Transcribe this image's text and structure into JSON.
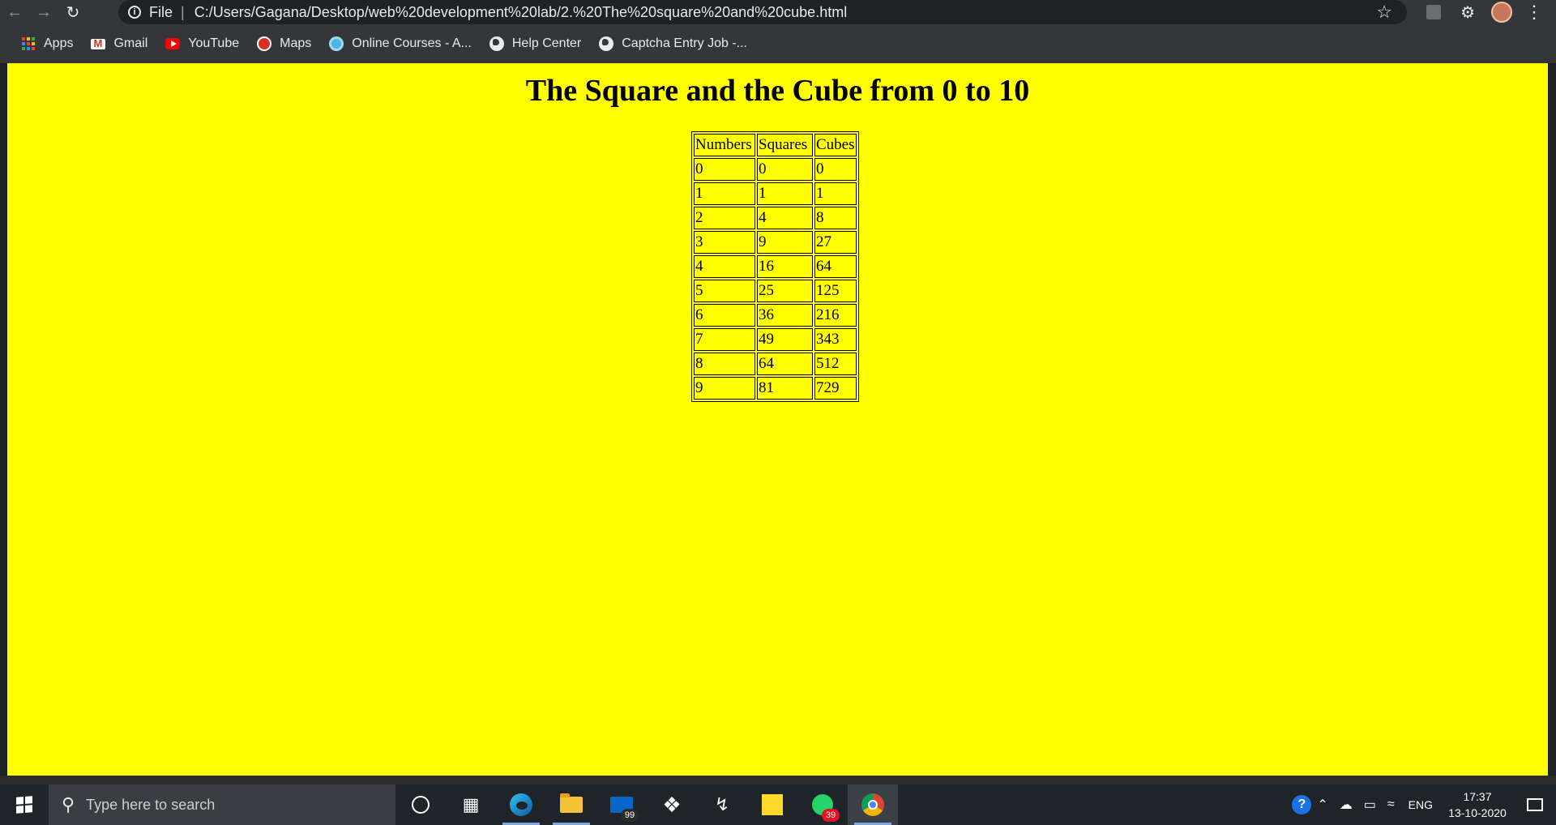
{
  "browser": {
    "url_scheme_label": "File",
    "url": "C:/Users/Gagana/Desktop/web%20development%20lab/2.%20The%20square%20and%20cube.html",
    "bookmarks": [
      {
        "label": "Apps",
        "icon": "apps-grid-icon"
      },
      {
        "label": "Gmail",
        "icon": "gmail-icon"
      },
      {
        "label": "YouTube",
        "icon": "youtube-icon"
      },
      {
        "label": "Maps",
        "icon": "maps-icon"
      },
      {
        "label": "Online Courses - A...",
        "icon": "online-courses-icon"
      },
      {
        "label": "Help Center",
        "icon": "globe-icon"
      },
      {
        "label": "Captcha Entry Job -...",
        "icon": "globe-icon"
      }
    ]
  },
  "page": {
    "title": "The Square and the Cube from 0 to 10",
    "background_color": "#ffff00",
    "table": {
      "headers": [
        "Numbers",
        "Squares",
        "Cubes"
      ],
      "rows": [
        [
          "0",
          "0",
          "0"
        ],
        [
          "1",
          "1",
          "1"
        ],
        [
          "2",
          "4",
          "8"
        ],
        [
          "3",
          "9",
          "27"
        ],
        [
          "4",
          "16",
          "64"
        ],
        [
          "5",
          "25",
          "125"
        ],
        [
          "6",
          "36",
          "216"
        ],
        [
          "7",
          "49",
          "343"
        ],
        [
          "8",
          "64",
          "512"
        ],
        [
          "9",
          "81",
          "729"
        ]
      ]
    }
  },
  "taskbar": {
    "search_placeholder": "Type here to search",
    "mail_badge": "99",
    "whatsapp_badge": "39",
    "language": "ENG",
    "time": "17:37",
    "date": "13-10-2020"
  }
}
